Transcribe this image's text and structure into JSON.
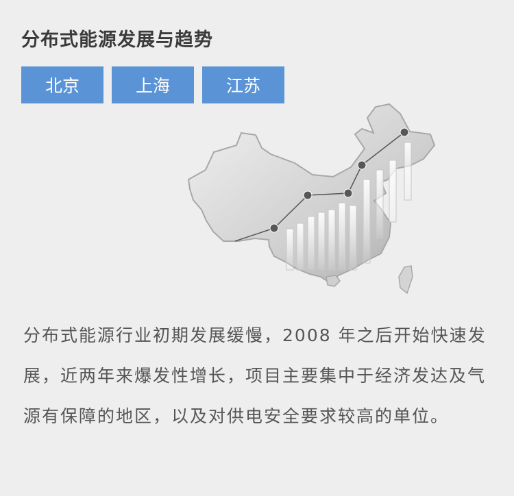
{
  "header": {
    "title": "分布式能源发展与趋势"
  },
  "tabs": [
    {
      "label": "北京"
    },
    {
      "label": "上海"
    },
    {
      "label": "江苏"
    }
  ],
  "description": "分布式能源行业初期发展缓慢，2008 年之后开始快速发展，近两年来爆发性增长，项目主要集中于经济发达及气源有保障的地区，以及对供电安全要求较高的单位。",
  "colors": {
    "tab_bg": "#5b94d6",
    "page_bg": "#eeeeee"
  }
}
